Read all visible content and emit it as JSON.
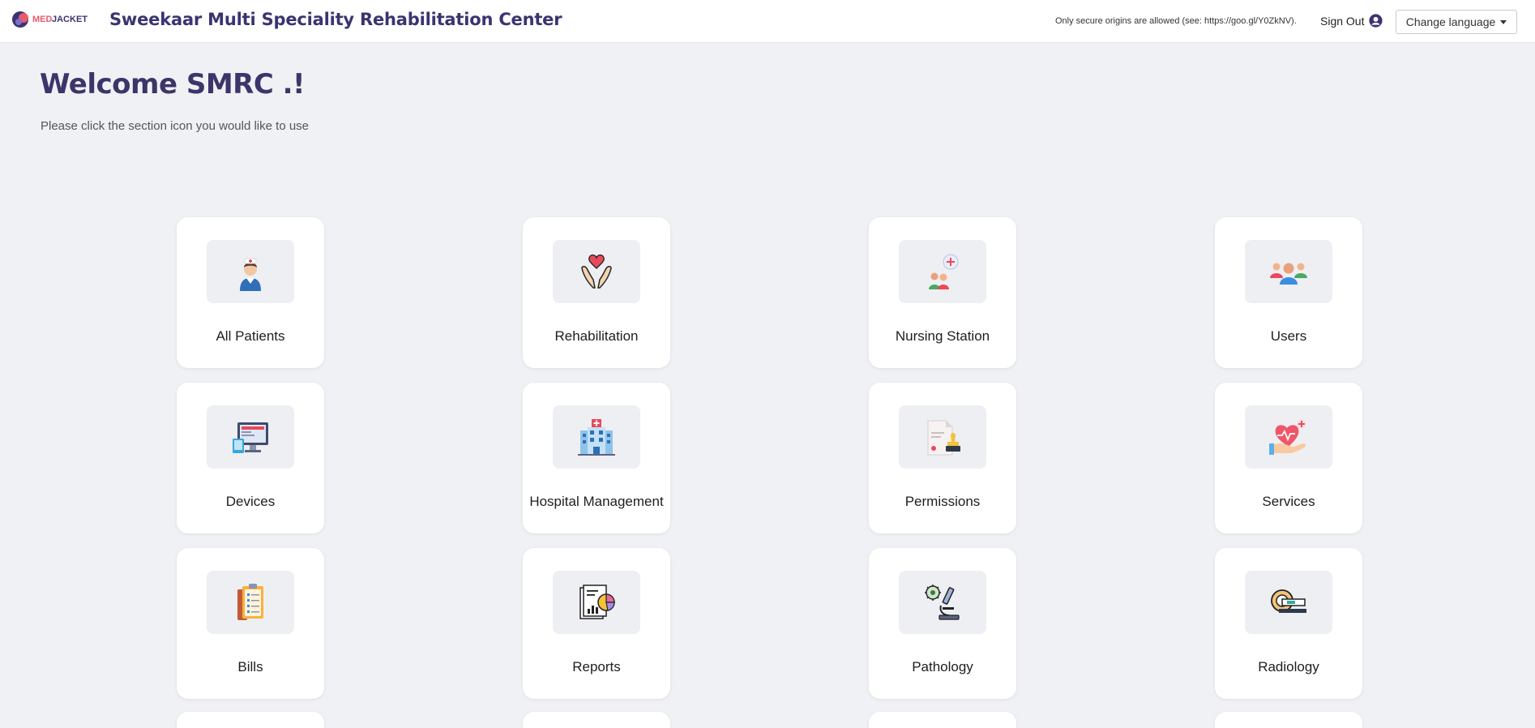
{
  "header": {
    "logo_text": "MEDJACKET",
    "app_title": "Sweekaar Multi Speciality Rehabilitation Center",
    "secure_note": "Only secure origins are allowed (see: https://goo.gl/Y0ZkNV).",
    "signout_label": "Sign Out",
    "language_button": "Change language"
  },
  "welcome": {
    "title": "Welcome SMRC .!",
    "subtitle": "Please click the section icon you would like to use"
  },
  "sections": [
    {
      "label": "All Patients",
      "icon": "nurse-icon"
    },
    {
      "label": "Rehabilitation",
      "icon": "hands-heart-icon"
    },
    {
      "label": "Nursing Station",
      "icon": "nursing-group-icon"
    },
    {
      "label": "Users",
      "icon": "users-icon"
    },
    {
      "label": "Devices",
      "icon": "devices-icon"
    },
    {
      "label": "Hospital Management",
      "icon": "hospital-icon"
    },
    {
      "label": "Permissions",
      "icon": "permission-stamp-icon"
    },
    {
      "label": "Services",
      "icon": "heart-hand-icon"
    },
    {
      "label": "Bills",
      "icon": "bill-clipboard-icon"
    },
    {
      "label": "Reports",
      "icon": "report-chart-icon"
    },
    {
      "label": "Pathology",
      "icon": "microscope-icon"
    },
    {
      "label": "Radiology",
      "icon": "mri-scanner-icon"
    }
  ]
}
